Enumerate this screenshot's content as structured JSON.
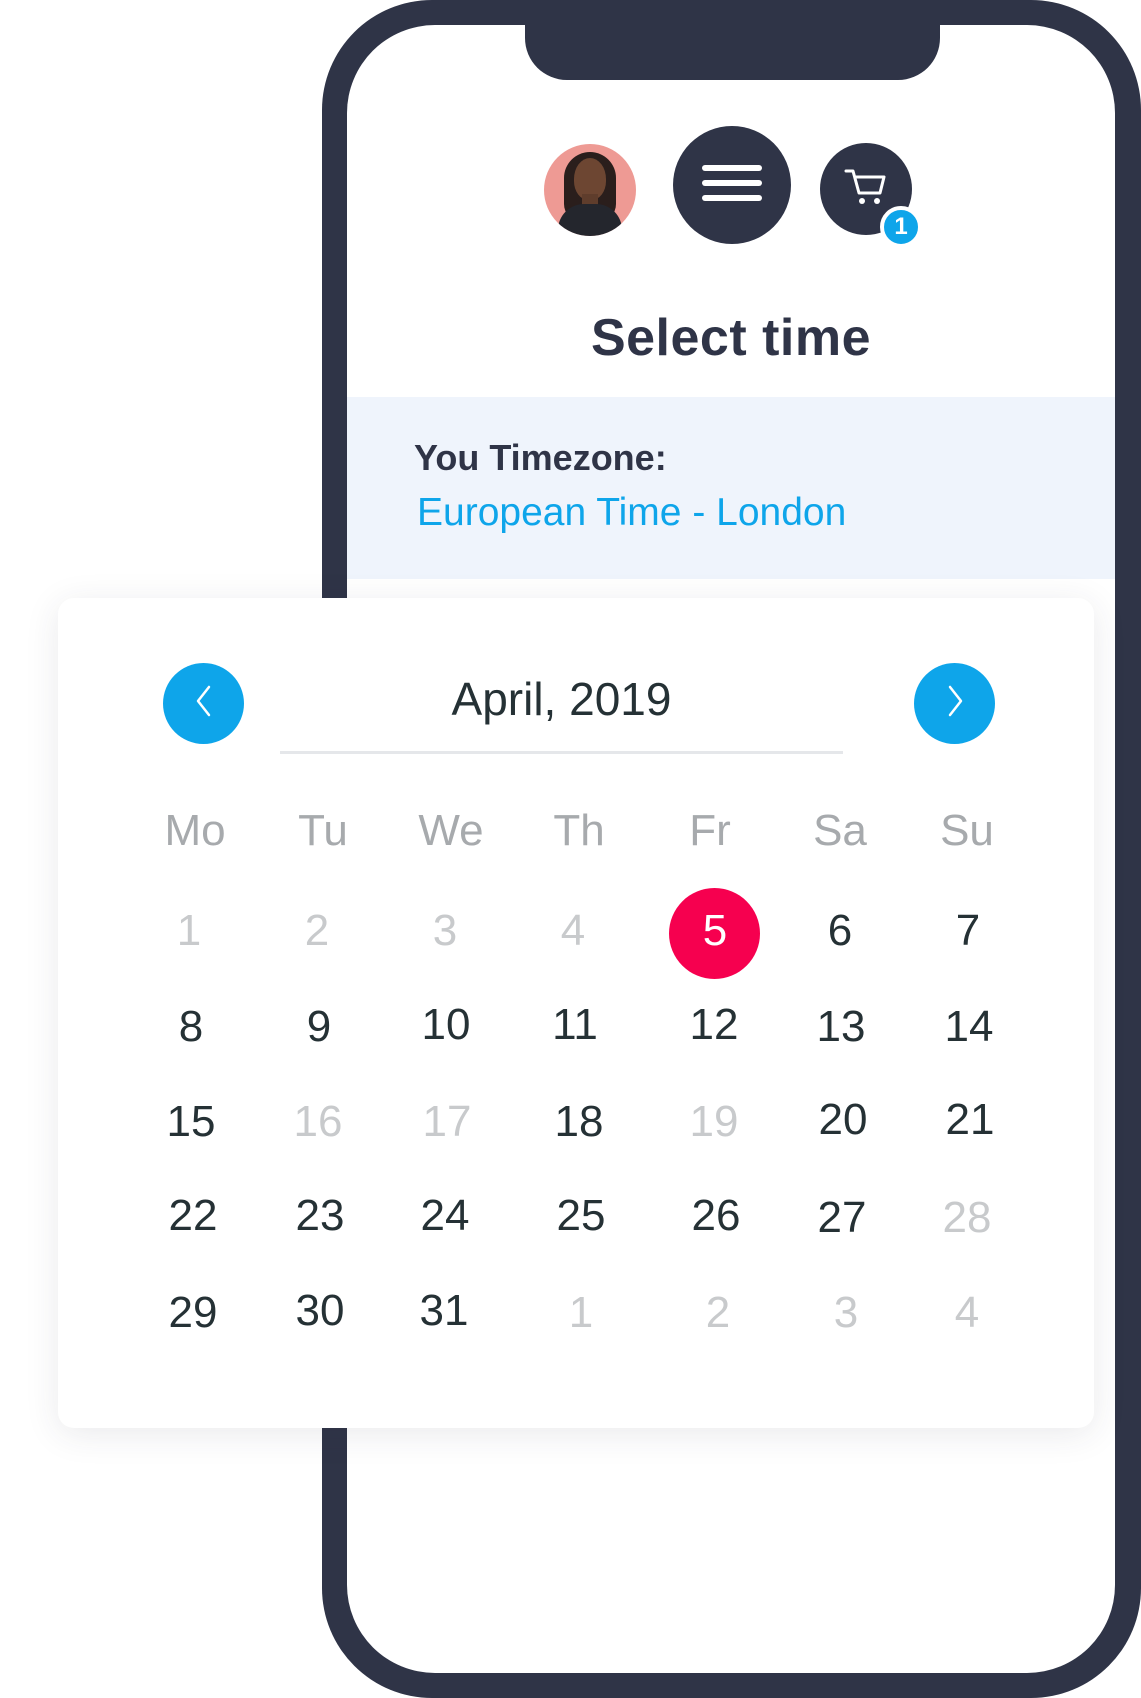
{
  "header": {
    "menu_icon": "hamburger-menu-icon",
    "cart_icon": "shopping-cart-icon",
    "cart_badge_count": "1"
  },
  "page": {
    "title": "Select time"
  },
  "timezone": {
    "label": "You Timezone:",
    "value": "European Time - London"
  },
  "calendar": {
    "month_label": "April, 2019",
    "prev_icon": "chevron-left-icon",
    "next_icon": "chevron-right-icon",
    "weekdays": [
      "Mo",
      "Tu",
      "We",
      "Th",
      "Fr",
      "Sa",
      "Su"
    ],
    "weeks": [
      [
        {
          "label": "1",
          "state": "disabled"
        },
        {
          "label": "2",
          "state": "disabled"
        },
        {
          "label": "3",
          "state": "disabled"
        },
        {
          "label": "4",
          "state": "disabled"
        },
        {
          "label": "5",
          "state": "selected"
        },
        {
          "label": "6",
          "state": "available"
        },
        {
          "label": "7",
          "state": "available"
        }
      ],
      [
        {
          "label": "8",
          "state": "available"
        },
        {
          "label": "9",
          "state": "available"
        },
        {
          "label": "10",
          "state": "available"
        },
        {
          "label": "11",
          "state": "available"
        },
        {
          "label": "12",
          "state": "available"
        },
        {
          "label": "13",
          "state": "available"
        },
        {
          "label": "14",
          "state": "available"
        }
      ],
      [
        {
          "label": "15",
          "state": "available"
        },
        {
          "label": "16",
          "state": "disabled"
        },
        {
          "label": "17",
          "state": "disabled"
        },
        {
          "label": "18",
          "state": "available"
        },
        {
          "label": "19",
          "state": "disabled"
        },
        {
          "label": "20",
          "state": "available"
        },
        {
          "label": "21",
          "state": "available"
        }
      ],
      [
        {
          "label": "22",
          "state": "available"
        },
        {
          "label": "23",
          "state": "available"
        },
        {
          "label": "24",
          "state": "available"
        },
        {
          "label": "25",
          "state": "available"
        },
        {
          "label": "26",
          "state": "available"
        },
        {
          "label": "27",
          "state": "available"
        },
        {
          "label": "28",
          "state": "disabled"
        }
      ],
      [
        {
          "label": "29",
          "state": "available"
        },
        {
          "label": "30",
          "state": "available"
        },
        {
          "label": "31",
          "state": "available"
        },
        {
          "label": "1",
          "state": "disabled"
        },
        {
          "label": "2",
          "state": "disabled"
        },
        {
          "label": "3",
          "state": "disabled"
        },
        {
          "label": "4",
          "state": "disabled"
        }
      ]
    ]
  },
  "colors": {
    "accent_blue": "#0ea5ea",
    "selected_red": "#f6004f",
    "frame_dark": "#2f3447",
    "text_dark": "#253135",
    "text_muted": "#c8cacc",
    "weekday_gray": "#a7aaad",
    "timezone_bg": "#eff4fc"
  }
}
